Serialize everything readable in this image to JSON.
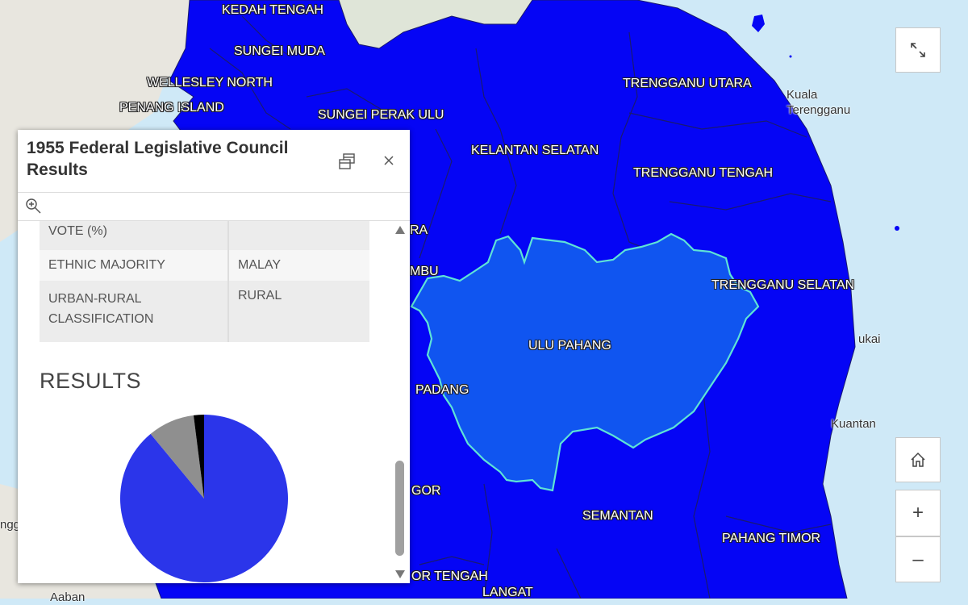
{
  "map": {
    "labels": {
      "kedah_tengah": "KEDAH TENGAH",
      "sungei_muda": "SUNGEI MUDA",
      "wellesley_north": "WELLESLEY NORTH",
      "penang_island": "PENANG ISLAND",
      "sungei_perak_ulu": "SUNGEI PERAK ULU",
      "trengganu_utara": "TRENGGANU UTARA",
      "kelantan_selatan": "KELANTAN SELATAN",
      "trengganu_tengah": "TRENGGANU TENGAH",
      "trengganu_selatan": "TRENGGANU SELATAN",
      "ulu_pahang": "ULU PAHANG",
      "semantan": "SEMANTAN",
      "pahang_timor": "PAHANG TIMOR",
      "ra_partial": "RA",
      "mbu_partial": "MBU",
      "padang_partial": "PADANG",
      "gor_partial": "GOR",
      "or_tengah_partial": "OR TENGAH",
      "langat": "LANGAT"
    },
    "base_labels": {
      "kuala_terengganu": "Kuala\nTerengganu",
      "kuantan": "Kuantan",
      "ukai": "ukai",
      "ngg_partial": "ngg",
      "aaban_partial": "Aaban"
    },
    "colors": {
      "water": "#cfe9f7",
      "land": "#e8e6df",
      "district": "#0505f5",
      "selected": "#1055f0",
      "selected_outline": "#5ee3d6"
    }
  },
  "controls": {
    "expand_icon": "expand-icon",
    "home_icon": "home-icon",
    "zoom_in": "+",
    "zoom_out": "–"
  },
  "popup": {
    "title": "1955 Federal Legislative Council Results",
    "attributes": [
      {
        "key": "VOTE (%)",
        "value": ""
      },
      {
        "key": "ETHNIC MAJORITY",
        "value": "MALAY"
      },
      {
        "key": "URBAN-RURAL CLASSIFICATION",
        "value": "RURAL"
      }
    ],
    "results_heading": "RESULTS",
    "pie": {
      "slices": [
        {
          "fraction": 0.89,
          "color": "#2b35ea"
        },
        {
          "fraction": 0.09,
          "color": "#8f8f8f"
        },
        {
          "fraction": 0.02,
          "color": "#000000"
        }
      ]
    }
  }
}
